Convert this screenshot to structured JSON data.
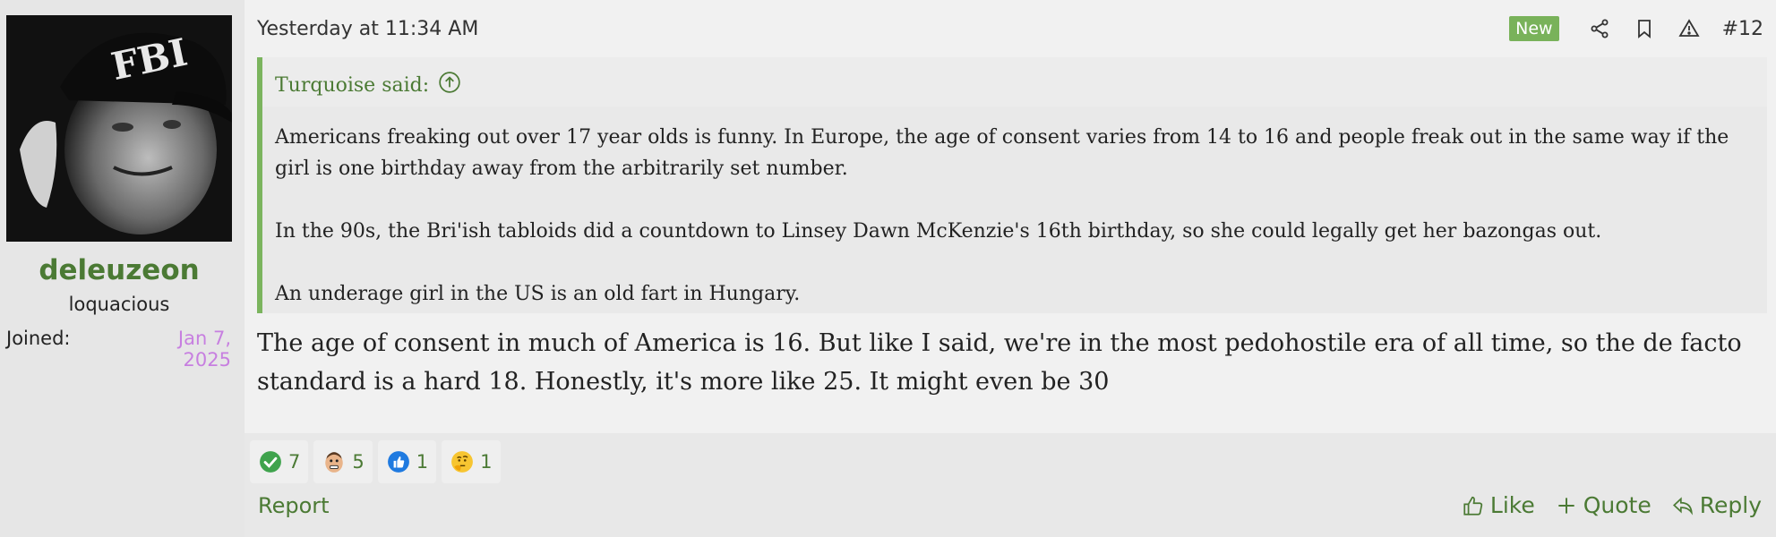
{
  "user": {
    "name": "deleuzeon",
    "title": "loquacious",
    "joined_label": "Joined:",
    "joined_date": "Jan 7, 2025",
    "avatar_cap_text": "FBI"
  },
  "post": {
    "date": "Yesterday at 11:34 AM",
    "badge": "New",
    "number": "#12",
    "quote": {
      "author": "Turquoise said:",
      "paragraphs": [
        "Americans freaking out over 17 year olds is funny. In Europe, the age of consent varies from 14 to 16 and people freak out in the same way if the girl is one birthday away from the arbitrarily set number.",
        "In the 90s, the Bri'ish tabloids did a countdown to Linsey Dawn McKenzie's 16th birthday, so she could legally get her bazongas out.",
        "An underage girl in the US is an old fart in Hungary."
      ]
    },
    "text": "The age of consent in much of America is 16. But like I said, we're in the most pedohostile era of all time, so the de facto standard is a hard 18. Honestly, it's more like 25. It might even be 30"
  },
  "reactions": [
    {
      "icon": "check-icon",
      "count": "7"
    },
    {
      "icon": "face-icon",
      "count": "5"
    },
    {
      "icon": "thumbs-up-icon",
      "count": "1"
    },
    {
      "icon": "thinking-face-icon",
      "count": "1"
    }
  ],
  "footer": {
    "report": "Report",
    "like": "Like",
    "quote": "Quote",
    "reply": "Reply"
  },
  "colors": {
    "accent": "#4b7a34",
    "badge": "#79b25a",
    "quote_border": "#7bb45e",
    "joined_date": "#c77fe0"
  }
}
